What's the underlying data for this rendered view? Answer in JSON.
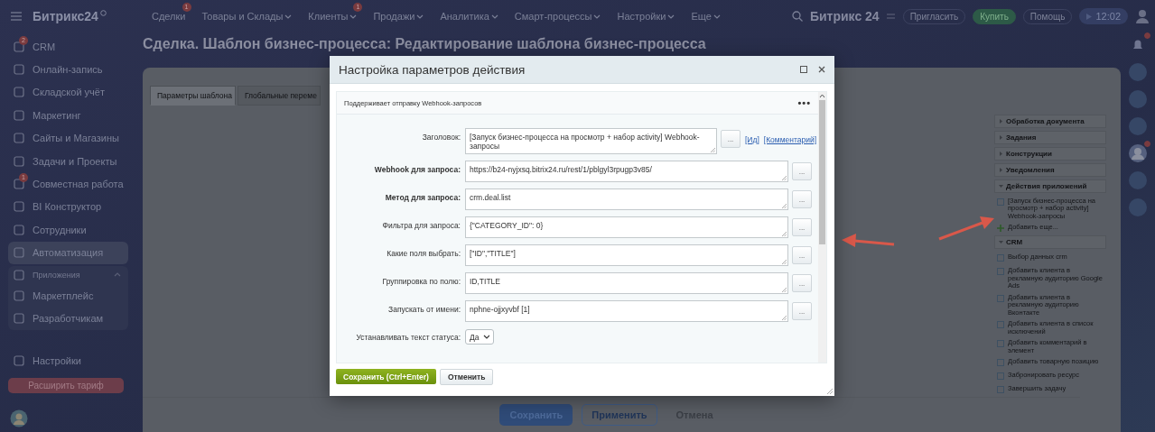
{
  "top_bar": {
    "logo": "Битрикс24",
    "menu": [
      {
        "label": "Сделки",
        "dropdown": false,
        "badge": "1"
      },
      {
        "label": "Товары и Склады",
        "dropdown": true
      },
      {
        "label": "Клиенты",
        "dropdown": true,
        "badge": "1"
      },
      {
        "label": "Продажи",
        "dropdown": true
      },
      {
        "label": "Аналитика",
        "dropdown": true
      },
      {
        "label": "Смарт-процессы",
        "dropdown": true
      },
      {
        "label": "Настройки",
        "dropdown": true
      },
      {
        "label": "Еще",
        "dropdown": true
      }
    ],
    "brand": "Битрикс 24",
    "buttons": [
      {
        "label": "Пригласить",
        "kind": "plain"
      },
      {
        "label": "Купить",
        "kind": "green"
      },
      {
        "label": "Помощь",
        "kind": "plain"
      }
    ],
    "time": "12:02"
  },
  "sidebar": {
    "items": [
      {
        "label": "CRM",
        "badge": "2",
        "selected": false
      },
      {
        "label": "Онлайн-запись",
        "selected": false
      },
      {
        "label": "Складской учёт",
        "selected": false
      },
      {
        "label": "Маркетинг",
        "selected": false
      },
      {
        "label": "Сайты и Магазины",
        "selected": false
      },
      {
        "label": "Задачи и Проекты",
        "selected": false
      },
      {
        "label": "Совместная работа",
        "badge": "1",
        "selected": false
      },
      {
        "label": "BI Конструктор",
        "selected": false
      },
      {
        "label": "Сотрудники",
        "selected": false
      },
      {
        "label": "Автоматизация",
        "selected": true
      }
    ],
    "group": {
      "label": "Приложения",
      "expanded": true,
      "children": [
        {
          "label": "Маркетплейс"
        },
        {
          "label": "Разработчикам"
        }
      ]
    },
    "settings": "Настройки",
    "upgrade": "Расширить тариф"
  },
  "page_title": "Сделка. Шаблон бизнес-процесса: Редактирование шаблона бизнес-процесса",
  "tabs": [
    {
      "label": "Параметры шаблона",
      "selected": true
    },
    {
      "label": "Глобальные переме",
      "selected": false
    }
  ],
  "toolbox": {
    "sections": [
      {
        "title": "Обработка документа",
        "expanded": false
      },
      {
        "title": "Задания",
        "expanded": false
      },
      {
        "title": "Конструкции",
        "expanded": false
      },
      {
        "title": "Уведомления",
        "expanded": false
      },
      {
        "title": "Действия приложений",
        "expanded": true,
        "items": [
          "[Запуск бизнес-процесса на просмотр + набор activity] Webhook-запросы"
        ],
        "add": "Добавить еще..."
      },
      {
        "title": "CRM",
        "expanded": true,
        "items": [
          "Выбор данных crm",
          "Добавить клиента в рекламную аудиторию Google Ads",
          "Добавить клиента в рекламную аудиторию Вконтакте",
          "Добавить клиента в список исключений",
          "Добавить комментарий в элемент",
          "Добавить товарную позицию",
          "Забронировать ресурс",
          "Завершить задачу"
        ]
      }
    ]
  },
  "bottom_buttons": [
    {
      "label": "Сохранить",
      "kind": "primary"
    },
    {
      "label": "Применить",
      "kind": "outline"
    },
    {
      "label": "Отмена",
      "kind": "plain"
    }
  ],
  "rail": [
    {
      "kind": "bell",
      "badge": true
    },
    {
      "kind": "circle",
      "badge": false
    },
    {
      "kind": "circle",
      "badge": false
    },
    {
      "kind": "circle",
      "badge": false
    },
    {
      "kind": "avatar",
      "badge": true
    },
    {
      "kind": "circle",
      "badge": false
    },
    {
      "kind": "circle",
      "badge": false
    }
  ],
  "dialog": {
    "title": "Настройка параметров действия",
    "description": "Поддерживает отправку Webhook-запросов",
    "menu": "•••",
    "rows": [
      {
        "label": "Заголовок:",
        "bold": false,
        "kind": "textarea",
        "value": "[Запуск бизнес-процесса на просмотр + набор activity] Webhook-запросы",
        "button": "...",
        "links": [
          "[Ид]",
          "[Комментарий]"
        ]
      },
      {
        "label": "Webhook для запроса:",
        "bold": true,
        "kind": "text",
        "value": "https://b24-nyjxsq.bitrix24.ru/rest/1/pblgyl3rpugp3v85/",
        "button": "..."
      },
      {
        "label": "Метод для запроса:",
        "bold": true,
        "kind": "text",
        "value": "crm.deal.list",
        "button": "..."
      },
      {
        "label": "Фильтра для запроса:",
        "bold": false,
        "kind": "text",
        "value": "{\"CATEGORY_ID\": 0}",
        "button": "..."
      },
      {
        "label": "Какие поля выбрать:",
        "bold": false,
        "kind": "text",
        "value": "[\"ID\",\"TITLE\"]",
        "button": "..."
      },
      {
        "label": "Группировка по полю:",
        "bold": false,
        "kind": "text",
        "value": "ID,TITLE",
        "button": "..."
      },
      {
        "label": "Запускать от имени:",
        "bold": false,
        "kind": "text",
        "value": "nphne-ojjxyvbf [1]",
        "button": "..."
      },
      {
        "label": "Устанавливать текст статуса:",
        "bold": false,
        "kind": "select",
        "value": "Да"
      }
    ],
    "save": "Сохранить (Ctrl+Enter)",
    "cancel": "Отменить"
  }
}
